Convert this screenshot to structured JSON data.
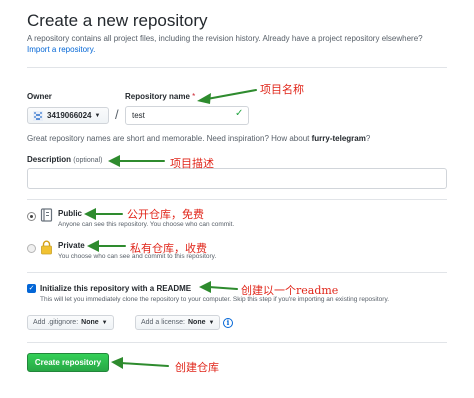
{
  "header": {
    "title": "Create a new repository",
    "subtitle": "A repository contains all project files, including the revision history. Already have a project repository elsewhere?",
    "import_link": "Import a repository."
  },
  "form": {
    "owner_label": "Owner",
    "owner_value": "3419066024",
    "repo_label": "Repository name",
    "repo_required": "*",
    "repo_value": "test",
    "name_hint_prefix": "Great repository names are short and memorable. Need inspiration? How about ",
    "name_hint_suggestion": "furry-telegram",
    "name_hint_suffix": "?",
    "desc_label": "Description",
    "desc_optional": "(optional)",
    "desc_value": ""
  },
  "visibility": {
    "public_title": "Public",
    "public_desc": "Anyone can see this repository. You choose who can commit.",
    "private_title": "Private",
    "private_desc": "You choose who can see and commit to this repository."
  },
  "init": {
    "checkbox_label": "Initialize this repository with a README",
    "checkbox_desc": "This will let you immediately clone the repository to your computer. Skip this step if you're importing an existing repository.",
    "gitignore_label": "Add .gitignore:",
    "gitignore_value": "None",
    "license_label": "Add a license:",
    "license_value": "None"
  },
  "submit": {
    "label": "Create repository"
  },
  "annotations": {
    "repo_name": "项目名称",
    "description": "项目描述",
    "public": "公开仓库，免费",
    "private": "私有仓库，收费",
    "readme": "创建以一个readme",
    "create": "创建仓库"
  },
  "colors": {
    "annotation": "#e0261a",
    "arrow": "#2e8b2e",
    "button": "#28a745",
    "link": "#0366d6"
  }
}
